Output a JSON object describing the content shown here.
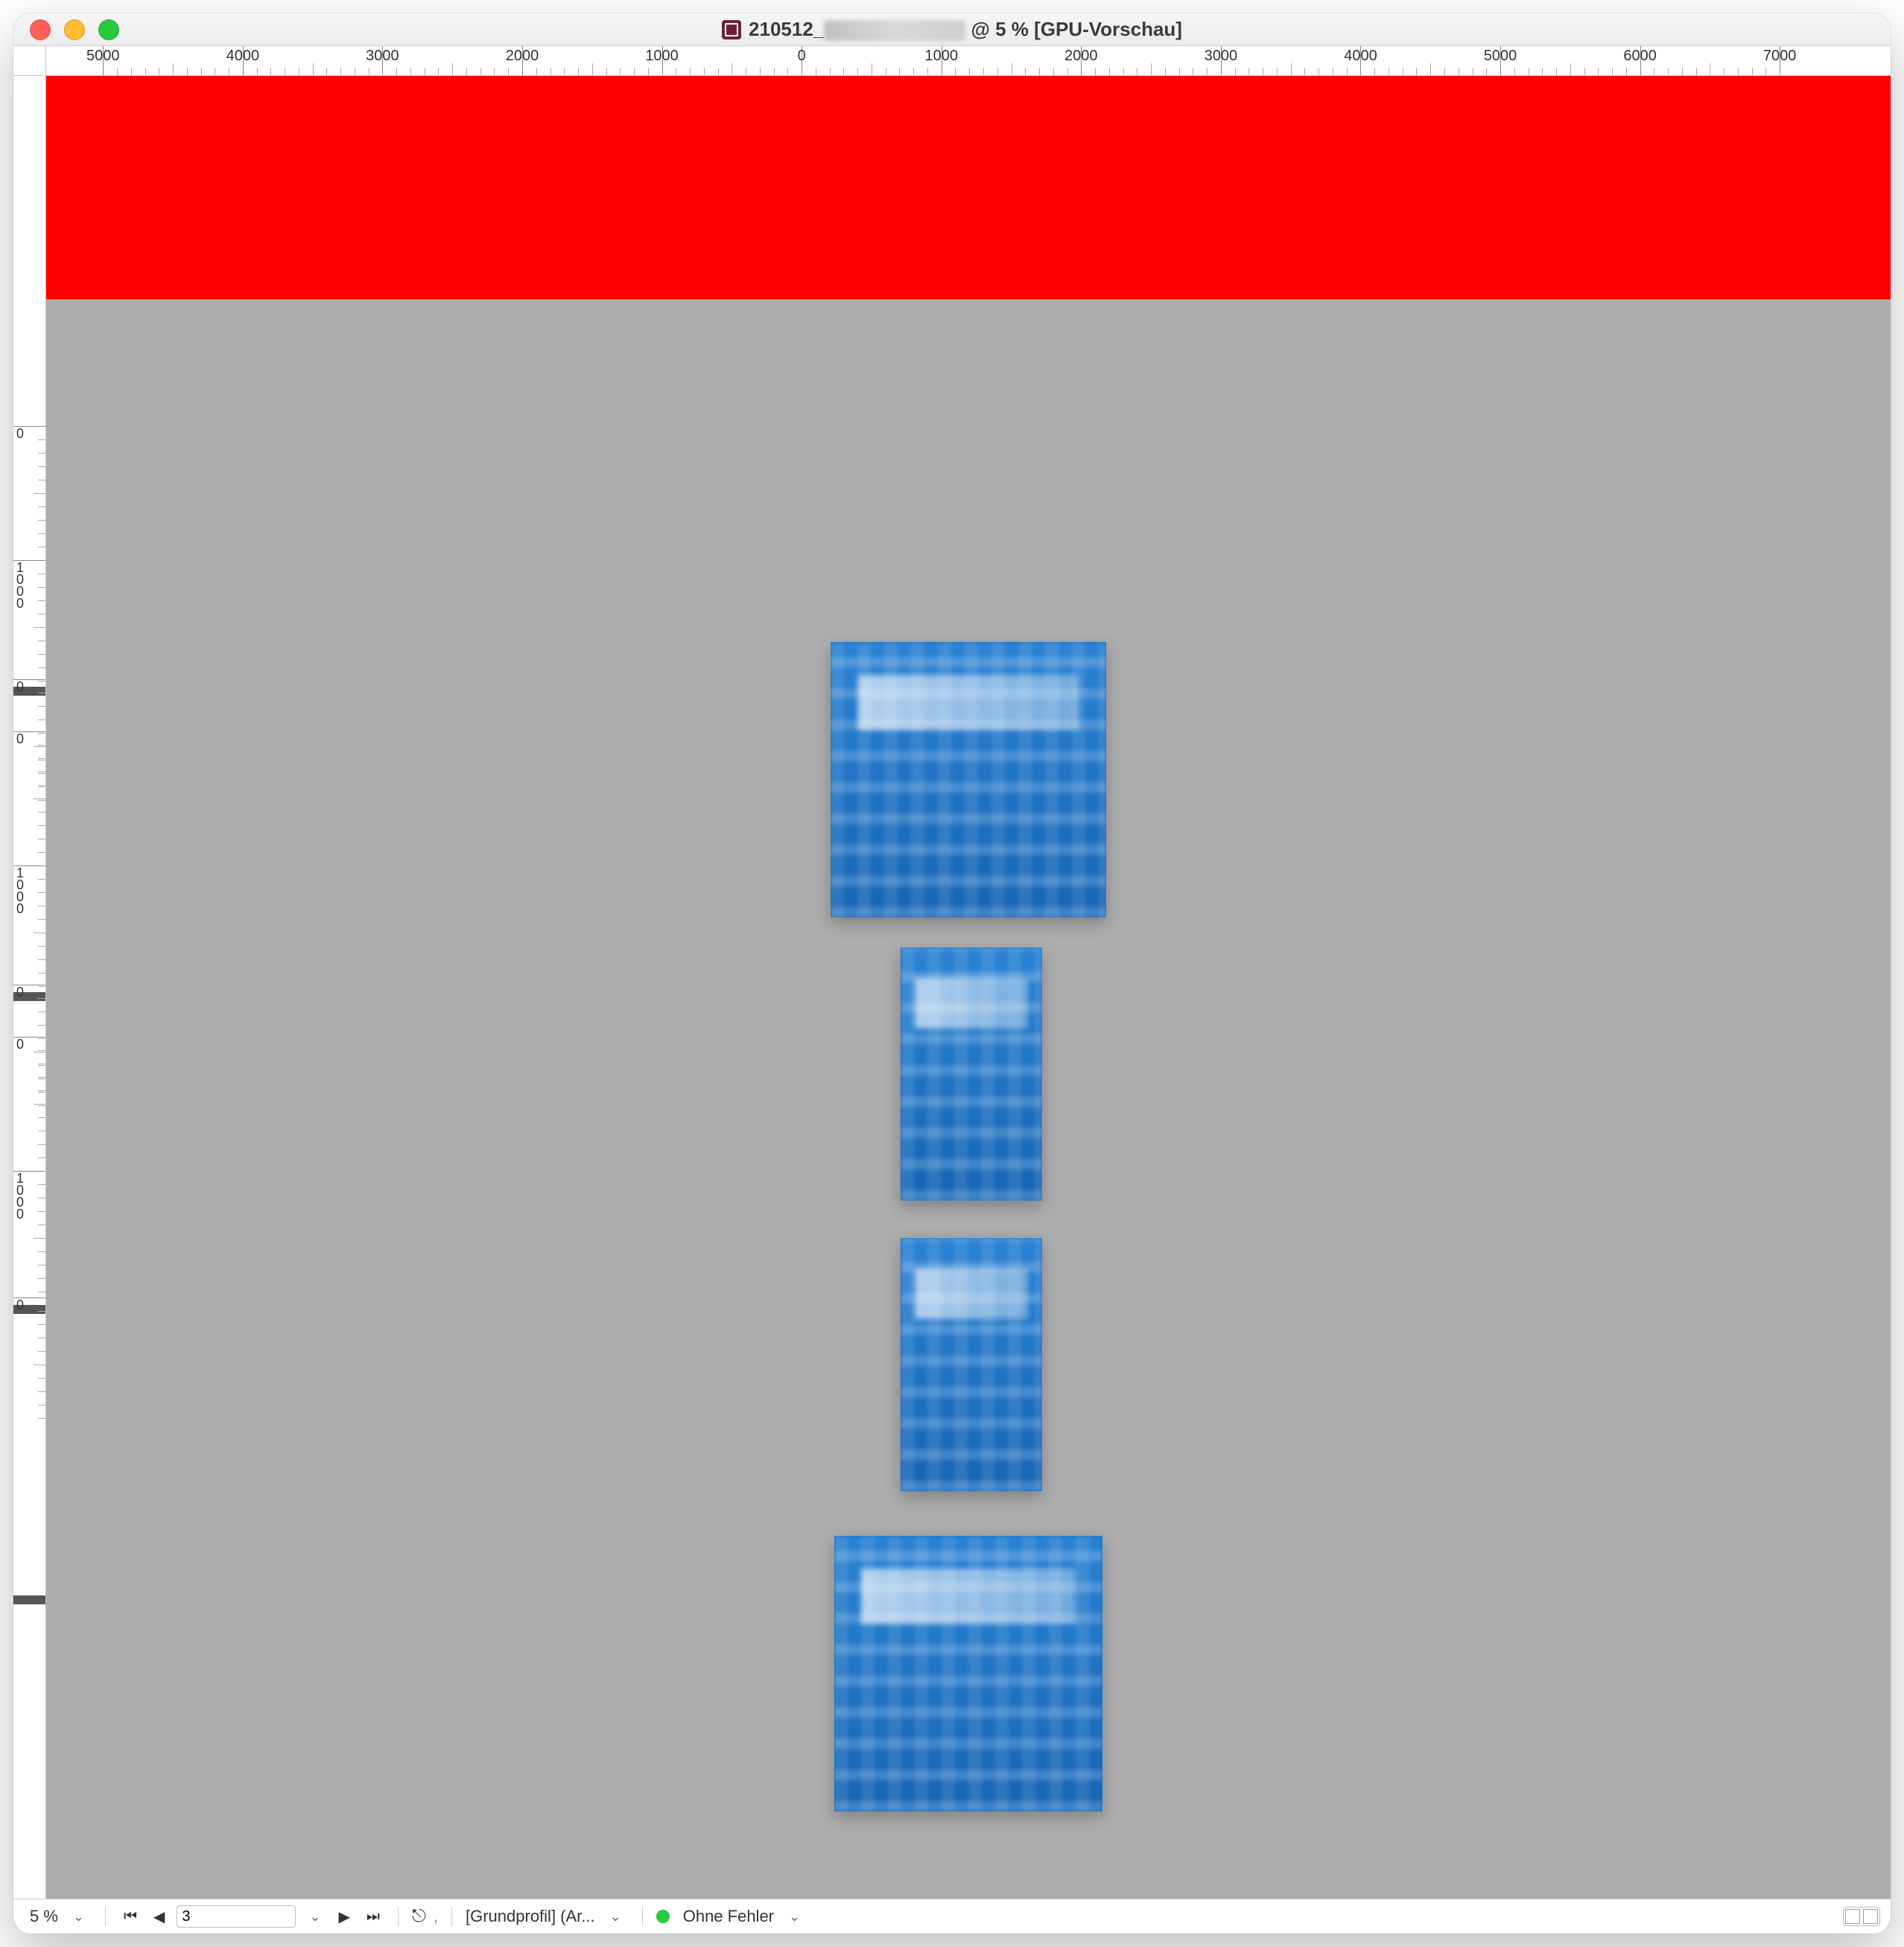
{
  "window": {
    "title_prefix": "210512_",
    "title_suffix": " @ 5 % [GPU-Vorschau]"
  },
  "colors": {
    "red_band": "#fe0000",
    "canvas_bg": "#adadad",
    "page_blue": "#1970c2"
  },
  "ruler": {
    "h_labels": [
      "5000",
      "4000",
      "3000",
      "2000",
      "1000",
      "0",
      "1000",
      "2000",
      "3000",
      "4000",
      "5000",
      "6000",
      "7000"
    ],
    "v_sequence": [
      "0",
      "1000",
      "0",
      "0",
      "1000",
      "0",
      "0",
      "1000",
      "0"
    ]
  },
  "status": {
    "zoom_label": "5 %",
    "page_value": "3",
    "preflight_profile": "[Grundprofil] (Ar...",
    "errors_label": "Ohne Fehler"
  }
}
